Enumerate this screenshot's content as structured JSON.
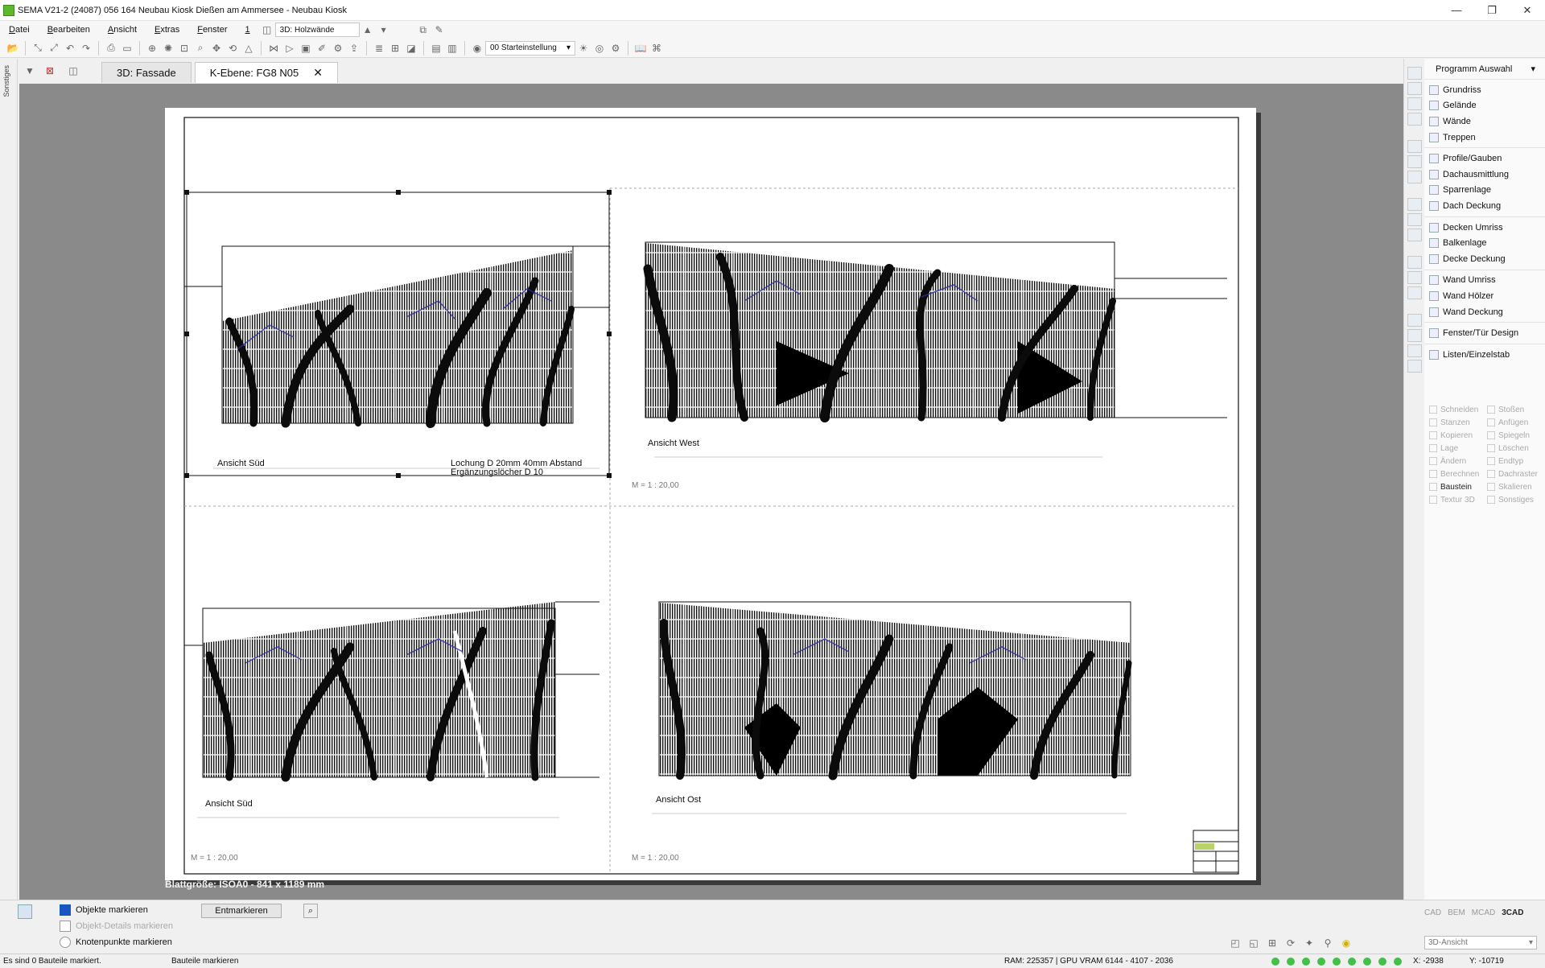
{
  "window": {
    "title": "SEMA V21-2 (24087) 056 164 Neubau Kiosk  Dießen am Ammersee - Neubau Kiosk",
    "minimize": "—",
    "maximize": "❐",
    "close": "✕"
  },
  "menu": {
    "items": [
      "Datei",
      "Bearbeiten",
      "Ansicht",
      "Extras",
      "Fenster",
      "1"
    ],
    "view_combo": "3D: Holzwände"
  },
  "toolbar": {
    "preset_combo": "00 Starteinstellung"
  },
  "left_strip": {
    "label": "Sonstiges"
  },
  "tabs": [
    {
      "label": "3D: Fassade",
      "active": false
    },
    {
      "label": "K-Ebene: FG8 N05",
      "active": true,
      "close": "✕"
    }
  ],
  "sheet": {
    "views": [
      {
        "label": "Ansicht Süd",
        "note_line1": "Lochung D 20mm 40mm Abstand",
        "note_line2": "Ergänzungslöcher D 10"
      },
      {
        "label": "Ansicht West",
        "scale": "M = 1 : 20,00"
      },
      {
        "label": "Ansicht Süd",
        "scale": "M = 1 : 20,00"
      },
      {
        "label": "Ansicht Ost",
        "scale": "M = 1 : 20,00"
      }
    ],
    "footer": "Blattgröße: ISOA0 - 841 x 1189 mm"
  },
  "right_panel": {
    "header": "Programm Auswahl",
    "groups": [
      [
        "Grundriss",
        "Gelände",
        "Wände",
        "Treppen"
      ],
      [
        "Profile/Gauben",
        "Dachausmittlung",
        "Sparrenlage",
        "Dach Deckung"
      ],
      [
        "Decken Umriss",
        "Balkenlage",
        "Decke Deckung"
      ],
      [
        "Wand Umriss",
        "Wand Hölzer",
        "Wand Deckung"
      ],
      [
        "Fenster/Tür Design"
      ],
      [
        "Listen/Einzelstab"
      ]
    ],
    "tools": [
      {
        "label": "Schneiden",
        "on": false
      },
      {
        "label": "Stoßen",
        "on": false
      },
      {
        "label": "Stanzen",
        "on": false
      },
      {
        "label": "Anfügen",
        "on": false
      },
      {
        "label": "Kopieren",
        "on": false
      },
      {
        "label": "Spiegeln",
        "on": false
      },
      {
        "label": "Lage",
        "on": false
      },
      {
        "label": "Löschen",
        "on": false
      },
      {
        "label": "Ändern",
        "on": false
      },
      {
        "label": "Endtyp",
        "on": false
      },
      {
        "label": "Berechnen",
        "on": false
      },
      {
        "label": "Dachraster",
        "on": false
      },
      {
        "label": "Baustein",
        "on": true
      },
      {
        "label": "Skalieren",
        "on": false
      },
      {
        "label": "Textur 3D",
        "on": false
      },
      {
        "label": "Sonstiges",
        "on": false
      }
    ]
  },
  "bottom": {
    "mark_objects": "Objekte markieren",
    "mark_details": "Objekt-Details markieren",
    "mark_nodes": "Knotenpunkte markieren",
    "unmark_button": "Entmarkieren",
    "modes": [
      "CAD",
      "BEM",
      "MCAD",
      "3CAD"
    ],
    "view_select": "3D-Ansicht"
  },
  "status": {
    "left": "Es sind 0 Bauteile markiert.",
    "center": "Bauteile markieren",
    "ram": "RAM: 225357 | GPU VRAM 6144 - 4107 - 2036",
    "x": "X: -2938",
    "y": "Y: -10719"
  },
  "colors": {
    "canvas_bg": "#8a8a8a",
    "accent_blue": "#1a56c2",
    "status_green": "#44c04a"
  }
}
